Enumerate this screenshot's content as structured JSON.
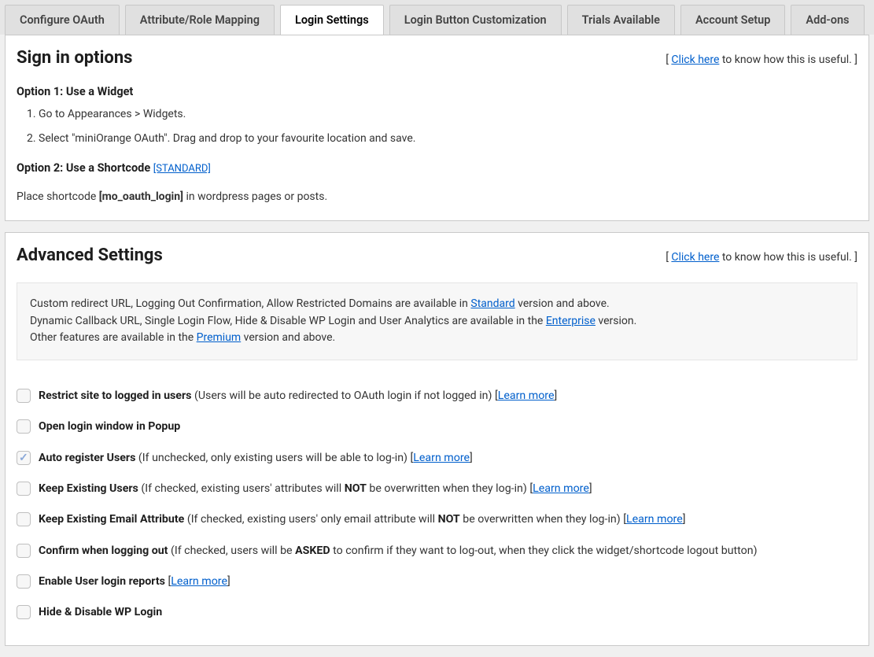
{
  "tabs": [
    {
      "label": "Configure OAuth",
      "active": false
    },
    {
      "label": "Attribute/Role Mapping",
      "active": false
    },
    {
      "label": "Login Settings",
      "active": true
    },
    {
      "label": "Login Button Customization",
      "active": false
    },
    {
      "label": "Trials Available",
      "active": false
    },
    {
      "label": "Account Setup",
      "active": false
    },
    {
      "label": "Add-ons",
      "active": false
    }
  ],
  "signin": {
    "title": "Sign in options",
    "hint_prefix": "[ ",
    "hint_link": "Click here",
    "hint_suffix": " to know how this is useful. ]",
    "option1_head": "Option 1: Use a Widget",
    "steps": [
      "Go to Appearances > Widgets.",
      "Select \"miniOrange OAuth\". Drag and drop to your favourite location and save."
    ],
    "option2_head": "Option 2: Use a Shortcode ",
    "option2_tag": "[STANDARD]",
    "shortcode_pre": "Place shortcode ",
    "shortcode_bold": "[mo_oauth_login]",
    "shortcode_post": " in wordpress pages or posts."
  },
  "advanced": {
    "title": "Advanced Settings",
    "hint_prefix": "[ ",
    "hint_link": "Click here",
    "hint_suffix": " to know how this is useful. ]",
    "notice": {
      "line1a": "Custom redirect URL, Logging Out Confirmation, Allow Restricted Domains are available in ",
      "line1_link": "Standard",
      "line1b": " version and above.",
      "line2a": "Dynamic Callback URL, Single Login Flow, Hide & Disable WP Login and User Analytics are available in the ",
      "line2_link": "Enterprise",
      "line2b": " version.",
      "line3a": "Other features are available in the ",
      "line3_link": "Premium",
      "line3b": " version and above."
    },
    "options": [
      {
        "checked": false,
        "bold": "Restrict site to logged in users",
        "rest": " (Users will be auto redirected to OAuth login if not logged in) [",
        "link": "Learn more",
        "after": "]"
      },
      {
        "checked": false,
        "bold": "Open login window in Popup",
        "rest": "",
        "link": "",
        "after": ""
      },
      {
        "checked": true,
        "bold": "Auto register Users",
        "rest": " (If unchecked, only existing users will be able to log-in) [",
        "link": "Learn more",
        "after": "]"
      },
      {
        "checked": false,
        "bold": "Keep Existing Users",
        "rest_html": " (If checked, existing users' attributes will <strong>NOT</strong> be overwritten when they log-in) [",
        "link": "Learn more",
        "after": "]"
      },
      {
        "checked": false,
        "bold": "Keep Existing Email Attribute",
        "rest_html": " (If checked, existing users' only email attribute will <strong>NOT</strong> be overwritten when they log-in) [",
        "link": "Learn more",
        "after": "]"
      },
      {
        "checked": false,
        "bold": "Confirm when logging out",
        "rest_html": " (If checked, users will be <strong>ASKED</strong> to confirm if they want to log-out, when they click the widget/shortcode logout button)",
        "link": "",
        "after": ""
      },
      {
        "checked": false,
        "bold": "Enable User login reports",
        "rest": " [",
        "link": "Learn more",
        "after": "]"
      },
      {
        "checked": false,
        "bold": "Hide & Disable WP Login",
        "rest": "",
        "link": "",
        "after": ""
      }
    ]
  }
}
